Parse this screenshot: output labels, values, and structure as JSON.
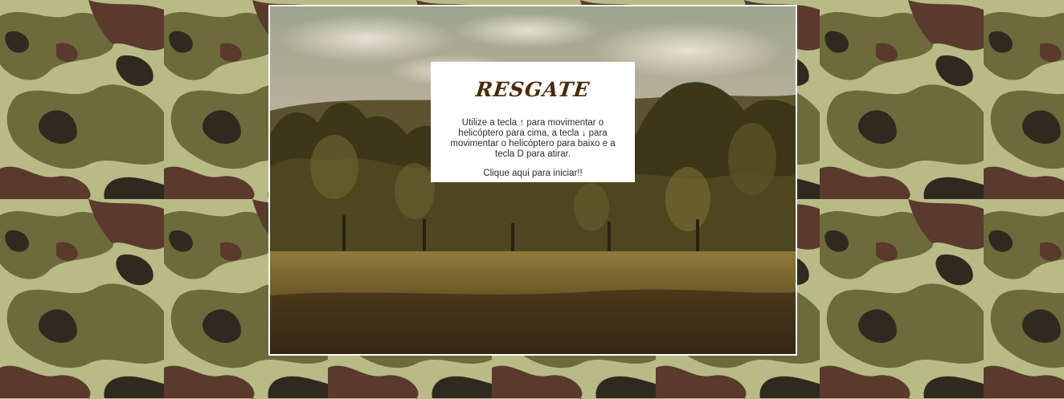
{
  "game": {
    "title": "RESGATE",
    "instructions": "Utilize a tecla ↑ para movimentar o helicóptero para cima, a tecla ↓ para movimentar o helicóptero para baixo e a tecla D para atirar.",
    "start_label": "Clique aqui para iniciar!!"
  },
  "colors": {
    "title": "#4a2a0c",
    "panel_bg": "#ffffff",
    "frame_border": "#ffffff",
    "camo_light": "#b8bb86",
    "camo_olive": "#6d6a3c",
    "camo_brown": "#5a3a2c",
    "camo_dark": "#2e2a20"
  },
  "scene": {
    "background": "forest-clearing",
    "background_pattern": "camouflage"
  }
}
